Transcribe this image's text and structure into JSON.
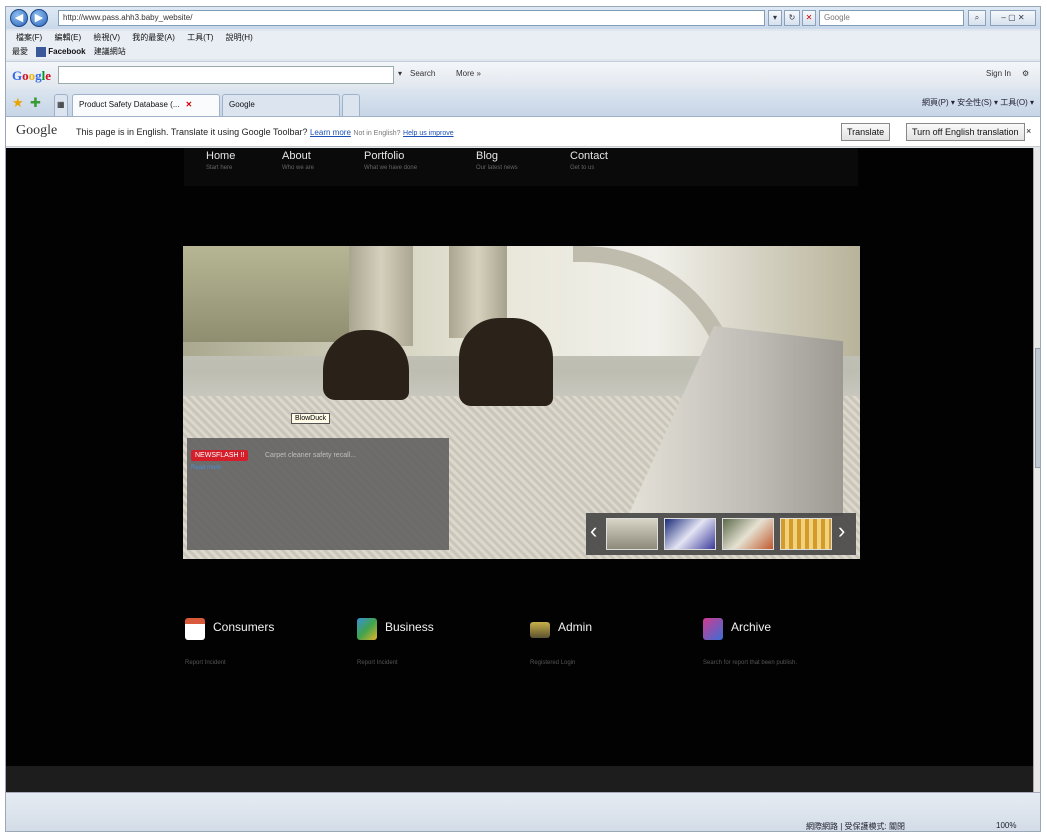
{
  "browser": {
    "address_url": "http://www.pass.ahh3.baby_website/",
    "search_placeholder": "Google",
    "menu": [
      "檔案(F)",
      "編輯(E)",
      "檢視(V)",
      "我的最愛(A)",
      "工具(T)",
      "說明(H)"
    ],
    "favorites_label": "最愛",
    "favorites_items": [
      "Facebook",
      "建議網站"
    ],
    "toolbar_search_label": "Search",
    "toolbar_more": "More »",
    "toolbar_signin": "Sign In",
    "tabs": [
      {
        "label": "Product Safety Database (...",
        "active": true
      },
      {
        "label": "Google",
        "active": false
      }
    ],
    "command_bar": "網頁(P) ▾  安全性(S) ▾  工具(O) ▾",
    "status_zone": "網際網路 | 受保護模式: 關閉",
    "status_zoom": "100%"
  },
  "translate_bar": {
    "logo": "Google",
    "message": "This page is in English. Translate it using Google Toolbar?",
    "learn_more": "Learn more",
    "not_english": "Not in English?",
    "help_us": "Help us improve",
    "translate_button": "Translate",
    "turn_off_button": "Turn off English translation"
  },
  "site": {
    "nav": [
      {
        "title": "Home",
        "sub": "Start here"
      },
      {
        "title": "About",
        "sub": "Who we are"
      },
      {
        "title": "Portfolio",
        "sub": "What we have done"
      },
      {
        "title": "Blog",
        "sub": "Our latest news"
      },
      {
        "title": "Contact",
        "sub": "Get to us"
      }
    ],
    "hero": {
      "tooltip": "BlowDuck",
      "badge": "NEWSFLASH !!",
      "caption": "Carpet cleaner safety recall...",
      "caption_link": "Read more"
    },
    "features": [
      {
        "title": "Consumers",
        "sub": "Report Incident",
        "color": "#d85a3a"
      },
      {
        "title": "Business",
        "sub": "Report Incident",
        "color": "#3fa34d"
      },
      {
        "title": "Admin",
        "sub": "Registered Login",
        "color": "#c8b048"
      },
      {
        "title": "Archive",
        "sub": "Search for report that been publish.",
        "color": "#d23a8e"
      }
    ]
  }
}
